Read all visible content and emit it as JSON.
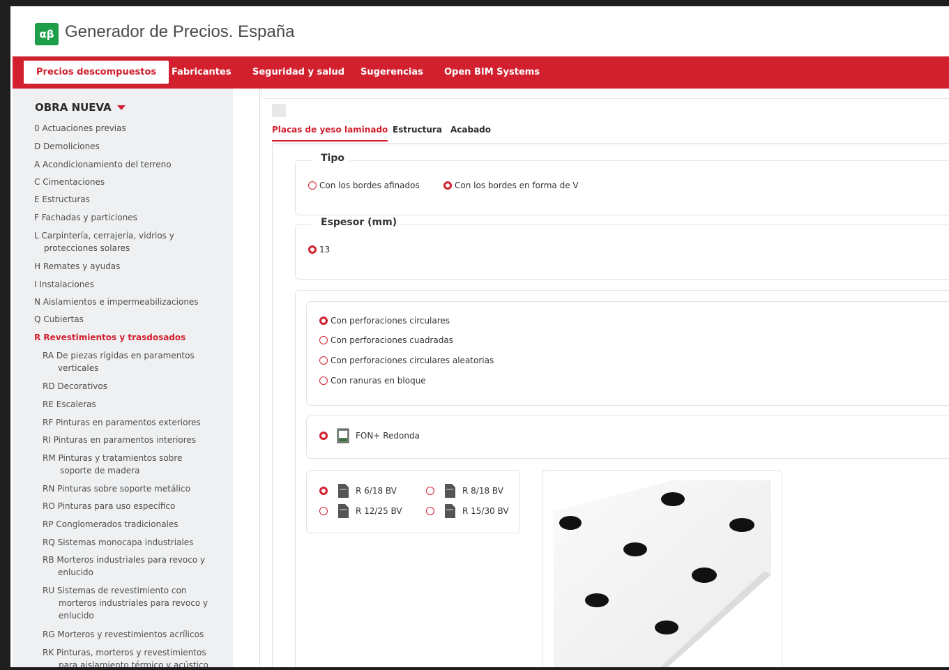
{
  "app": {
    "logo_text": "αβ",
    "title": "Generador de Precios. España"
  },
  "nav": {
    "items": [
      "Precios descompuestos",
      "Fabricantes",
      "Seguridad y salud",
      "Sugerencias",
      "Open BIM Systems"
    ]
  },
  "sidebar": {
    "heading": "OBRA NUEVA",
    "items": [
      "0  Actuaciones previas",
      "D  Demoliciones",
      "A  Acondicionamiento del terreno",
      "C  Cimentaciones",
      "E  Estructuras",
      "F  Fachadas y particiones",
      "L  Carpintería, cerrajería, vidrios y",
      "protecciones solares",
      "H  Remates y ayudas",
      "I  Instalaciones",
      "N  Aislamientos e impermeabilizaciones",
      "Q  Cubiertas",
      "R  Revestimientos y trasdosados",
      "RA  De piezas rígidas en paramentos",
      "verticales",
      "RD  Decorativos",
      "RE  Escaleras",
      "RF  Pinturas en paramentos exteriores",
      "RI  Pinturas en paramentos interiores",
      "RM  Pinturas y tratamientos sobre",
      "soporte de madera",
      "RN  Pinturas sobre soporte metálico",
      "RO  Pinturas para uso específico",
      "RP  Conglomerados tradicionales",
      "RQ  Sistemas monocapa industriales",
      "RB  Morteros industriales para revoco y",
      "enlucido",
      "RU  Sistemas de revestimiento con",
      "morteros industriales para revoco y",
      "enlucido",
      "RG  Morteros y revestimientos acrílicos",
      "RK  Pinturas, morteros y revestimientos",
      "para aislamiento térmico y acústico"
    ]
  },
  "tabs": [
    "Placas de yeso laminado",
    "Estructura",
    "Acabado"
  ],
  "tipo": {
    "legend": "Tipo",
    "options": [
      "Con los bordes afinados",
      "Con los bordes en forma de V"
    ],
    "selected": 1
  },
  "espesor": {
    "legend": "Espesor (mm)",
    "options": [
      "13"
    ],
    "selected": 0
  },
  "perforaciones": {
    "options": [
      "Con perforaciones circulares",
      "Con perforaciones cuadradas",
      "Con perforaciones circulares aleatorias",
      "Con ranuras en bloque"
    ],
    "selected": 0
  },
  "producto": {
    "label": "FON+ Redonda",
    "icon": "dwg-file-icon"
  },
  "modelos": {
    "options": [
      "R 6/18 BV",
      "R 8/18 BV",
      "R 12/25 BV",
      "R 15/30 BV"
    ],
    "selected": 0
  },
  "colors": {
    "brand_red": "#d2202f",
    "logo_green": "#1f9e4a",
    "sidebar_bg": "#eef0f2"
  }
}
